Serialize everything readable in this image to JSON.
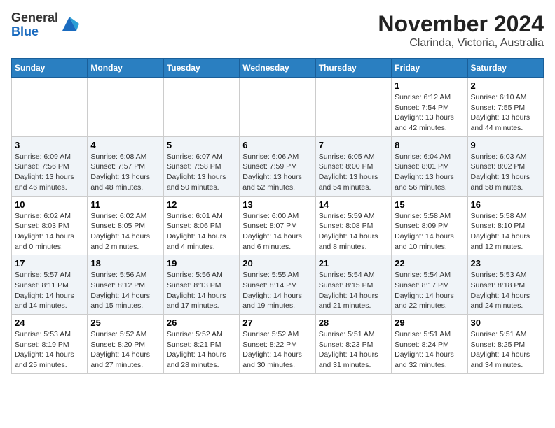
{
  "logo": {
    "general": "General",
    "blue": "Blue"
  },
  "title": "November 2024",
  "subtitle": "Clarinda, Victoria, Australia",
  "days_of_week": [
    "Sunday",
    "Monday",
    "Tuesday",
    "Wednesday",
    "Thursday",
    "Friday",
    "Saturday"
  ],
  "weeks": [
    [
      {
        "day": "",
        "info": ""
      },
      {
        "day": "",
        "info": ""
      },
      {
        "day": "",
        "info": ""
      },
      {
        "day": "",
        "info": ""
      },
      {
        "day": "",
        "info": ""
      },
      {
        "day": "1",
        "info": "Sunrise: 6:12 AM\nSunset: 7:54 PM\nDaylight: 13 hours and 42 minutes."
      },
      {
        "day": "2",
        "info": "Sunrise: 6:10 AM\nSunset: 7:55 PM\nDaylight: 13 hours and 44 minutes."
      }
    ],
    [
      {
        "day": "3",
        "info": "Sunrise: 6:09 AM\nSunset: 7:56 PM\nDaylight: 13 hours and 46 minutes."
      },
      {
        "day": "4",
        "info": "Sunrise: 6:08 AM\nSunset: 7:57 PM\nDaylight: 13 hours and 48 minutes."
      },
      {
        "day": "5",
        "info": "Sunrise: 6:07 AM\nSunset: 7:58 PM\nDaylight: 13 hours and 50 minutes."
      },
      {
        "day": "6",
        "info": "Sunrise: 6:06 AM\nSunset: 7:59 PM\nDaylight: 13 hours and 52 minutes."
      },
      {
        "day": "7",
        "info": "Sunrise: 6:05 AM\nSunset: 8:00 PM\nDaylight: 13 hours and 54 minutes."
      },
      {
        "day": "8",
        "info": "Sunrise: 6:04 AM\nSunset: 8:01 PM\nDaylight: 13 hours and 56 minutes."
      },
      {
        "day": "9",
        "info": "Sunrise: 6:03 AM\nSunset: 8:02 PM\nDaylight: 13 hours and 58 minutes."
      }
    ],
    [
      {
        "day": "10",
        "info": "Sunrise: 6:02 AM\nSunset: 8:03 PM\nDaylight: 14 hours and 0 minutes."
      },
      {
        "day": "11",
        "info": "Sunrise: 6:02 AM\nSunset: 8:05 PM\nDaylight: 14 hours and 2 minutes."
      },
      {
        "day": "12",
        "info": "Sunrise: 6:01 AM\nSunset: 8:06 PM\nDaylight: 14 hours and 4 minutes."
      },
      {
        "day": "13",
        "info": "Sunrise: 6:00 AM\nSunset: 8:07 PM\nDaylight: 14 hours and 6 minutes."
      },
      {
        "day": "14",
        "info": "Sunrise: 5:59 AM\nSunset: 8:08 PM\nDaylight: 14 hours and 8 minutes."
      },
      {
        "day": "15",
        "info": "Sunrise: 5:58 AM\nSunset: 8:09 PM\nDaylight: 14 hours and 10 minutes."
      },
      {
        "day": "16",
        "info": "Sunrise: 5:58 AM\nSunset: 8:10 PM\nDaylight: 14 hours and 12 minutes."
      }
    ],
    [
      {
        "day": "17",
        "info": "Sunrise: 5:57 AM\nSunset: 8:11 PM\nDaylight: 14 hours and 14 minutes."
      },
      {
        "day": "18",
        "info": "Sunrise: 5:56 AM\nSunset: 8:12 PM\nDaylight: 14 hours and 15 minutes."
      },
      {
        "day": "19",
        "info": "Sunrise: 5:56 AM\nSunset: 8:13 PM\nDaylight: 14 hours and 17 minutes."
      },
      {
        "day": "20",
        "info": "Sunrise: 5:55 AM\nSunset: 8:14 PM\nDaylight: 14 hours and 19 minutes."
      },
      {
        "day": "21",
        "info": "Sunrise: 5:54 AM\nSunset: 8:15 PM\nDaylight: 14 hours and 21 minutes."
      },
      {
        "day": "22",
        "info": "Sunrise: 5:54 AM\nSunset: 8:17 PM\nDaylight: 14 hours and 22 minutes."
      },
      {
        "day": "23",
        "info": "Sunrise: 5:53 AM\nSunset: 8:18 PM\nDaylight: 14 hours and 24 minutes."
      }
    ],
    [
      {
        "day": "24",
        "info": "Sunrise: 5:53 AM\nSunset: 8:19 PM\nDaylight: 14 hours and 25 minutes."
      },
      {
        "day": "25",
        "info": "Sunrise: 5:52 AM\nSunset: 8:20 PM\nDaylight: 14 hours and 27 minutes."
      },
      {
        "day": "26",
        "info": "Sunrise: 5:52 AM\nSunset: 8:21 PM\nDaylight: 14 hours and 28 minutes."
      },
      {
        "day": "27",
        "info": "Sunrise: 5:52 AM\nSunset: 8:22 PM\nDaylight: 14 hours and 30 minutes."
      },
      {
        "day": "28",
        "info": "Sunrise: 5:51 AM\nSunset: 8:23 PM\nDaylight: 14 hours and 31 minutes."
      },
      {
        "day": "29",
        "info": "Sunrise: 5:51 AM\nSunset: 8:24 PM\nDaylight: 14 hours and 32 minutes."
      },
      {
        "day": "30",
        "info": "Sunrise: 5:51 AM\nSunset: 8:25 PM\nDaylight: 14 hours and 34 minutes."
      }
    ]
  ]
}
